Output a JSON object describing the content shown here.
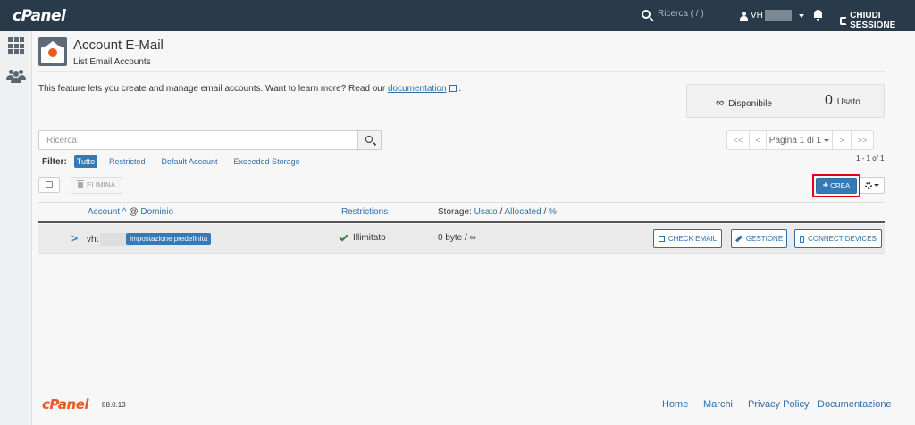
{
  "topbar": {
    "logo": "cPanel",
    "search_placeholder": "Ricerca ( / )",
    "user": "VH",
    "logout": "CHIUDI SESSIONE"
  },
  "header": {
    "title": "Account E-Mail",
    "subtitle": "List Email Accounts"
  },
  "intro": {
    "text": "This feature lets you create and manage email accounts. Want to learn more? Read our",
    "link": "documentation",
    "suffix": "."
  },
  "stats": {
    "available_symbol": "∞",
    "available_label": "Disponibile",
    "used_count": "0",
    "used_label": "Usato"
  },
  "search": {
    "placeholder": "Ricerca"
  },
  "pagination": {
    "first": "<<",
    "prev": "<",
    "page_label": "Pagina 1 di 1",
    "next": ">",
    "last": ">>",
    "range": "1 - 1 of 1"
  },
  "filter": {
    "label": "Filter:",
    "options": [
      "Tutto",
      "Restricted",
      "Default Account",
      "Exceeded Storage"
    ],
    "active": "Tutto"
  },
  "actions": {
    "delete_label": "ELIMINA",
    "create_label": "CREA"
  },
  "table": {
    "headers": {
      "account": "Account",
      "at": "@",
      "domain": "Dominio",
      "restrictions": "Restrictions",
      "storage_prefix": "Storage:",
      "storage_used": "Usato",
      "sep1": "/",
      "storage_allocated": "Allocated",
      "sep2": "/",
      "storage_pct": "%"
    },
    "rows": [
      {
        "account": "vht",
        "badge": "Impostazione predefinita",
        "restriction": "Illimitato",
        "storage": "0 byte / ∞",
        "btn_check": "CHECK EMAIL",
        "btn_manage": "GESTIONE",
        "btn_connect": "CONNECT DEVICES"
      }
    ]
  },
  "footer": {
    "logo": "cPanel",
    "version": "88.0.13",
    "links": [
      "Home",
      "Marchi",
      "Privacy Policy",
      "Documentazione"
    ]
  },
  "colors": {
    "topbar": "#293a4a",
    "accent": "#337ab7",
    "brand_orange": "#e85a23",
    "highlight": "#e3000f"
  }
}
